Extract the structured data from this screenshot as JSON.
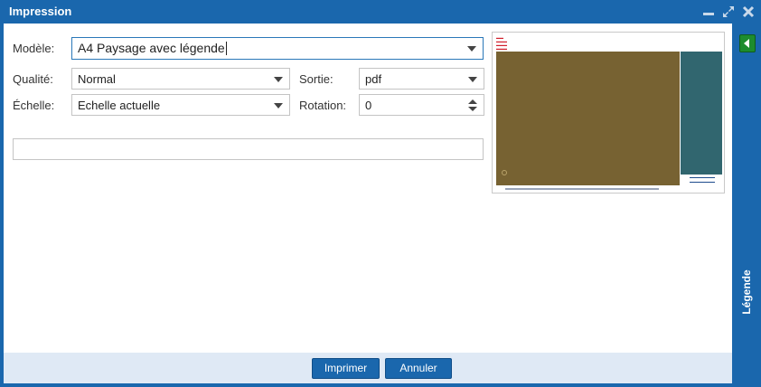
{
  "window": {
    "title": "Impression"
  },
  "form": {
    "modele": {
      "label": "Modèle:",
      "value": "A4 Paysage avec légende"
    },
    "qualite": {
      "label": "Qualité:",
      "value": "Normal"
    },
    "sortie": {
      "label": "Sortie:",
      "value": "pdf"
    },
    "echelle": {
      "label": "Échelle:",
      "value": "Echelle actuelle"
    },
    "rotation": {
      "label": "Rotation:",
      "value": "0"
    },
    "comment": {
      "value": ""
    }
  },
  "legend": {
    "label": "Légende"
  },
  "buttons": {
    "print": "Imprimer",
    "cancel": "Annuler"
  },
  "colors": {
    "accent": "#1a67ad",
    "map_preview": "#776232",
    "legend_preview": "#31666f",
    "legend_toggle": "#1d8c2e"
  },
  "icons": {
    "minimize": "minimize-icon",
    "maximize": "maximize-icon",
    "close": "close-icon",
    "legend_toggle": "arrow-left-icon"
  }
}
